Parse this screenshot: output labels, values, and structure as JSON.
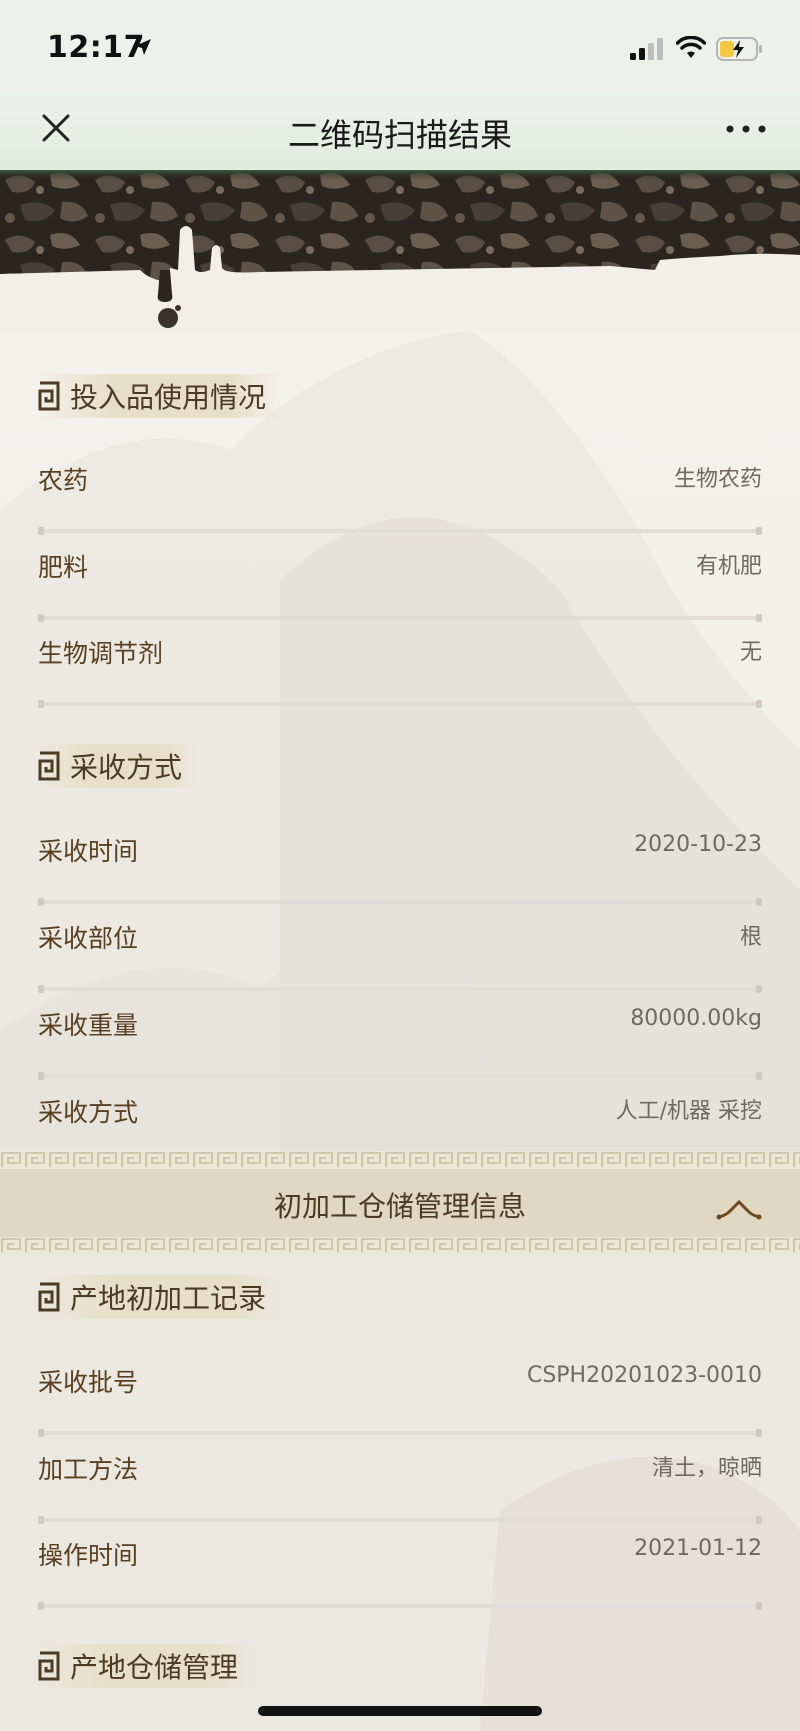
{
  "status_bar": {
    "time": "12:17"
  },
  "nav": {
    "title": "二维码扫描结果"
  },
  "sections": {
    "inputs": {
      "title": "投入品使用情况",
      "rows": [
        {
          "label": "农药",
          "value": "生物农药"
        },
        {
          "label": "肥料",
          "value": "有机肥"
        },
        {
          "label": "生物调节剂",
          "value": "无"
        }
      ]
    },
    "harvest": {
      "title": "采收方式",
      "rows": [
        {
          "label": "采收时间",
          "value": "2020-10-23"
        },
        {
          "label": "采收部位",
          "value": "根"
        },
        {
          "label": "采收重量",
          "value": "80000.00kg"
        },
        {
          "label": "采收方式",
          "value": "人工/机器 采挖"
        }
      ]
    },
    "storage_header": {
      "title": "初加工仓储管理信息"
    },
    "processing": {
      "title": "产地初加工记录",
      "rows": [
        {
          "label": "采收批号",
          "value": "CSPH20201023-0010"
        },
        {
          "label": "加工方法",
          "value": "清土，晾晒"
        },
        {
          "label": "操作时间",
          "value": "2021-01-12"
        }
      ]
    },
    "warehouse": {
      "title": "产地仓储管理"
    }
  },
  "icons": {
    "close": "close-icon",
    "more": "more-dots-icon",
    "section": "fret-square-icon",
    "collapse": "chevron-up-icon"
  },
  "colors": {
    "title_brown": "#4d3a22",
    "label_brown": "#5a3f20",
    "value_gray": "#6e6a63",
    "band": "#e0d8c2"
  }
}
